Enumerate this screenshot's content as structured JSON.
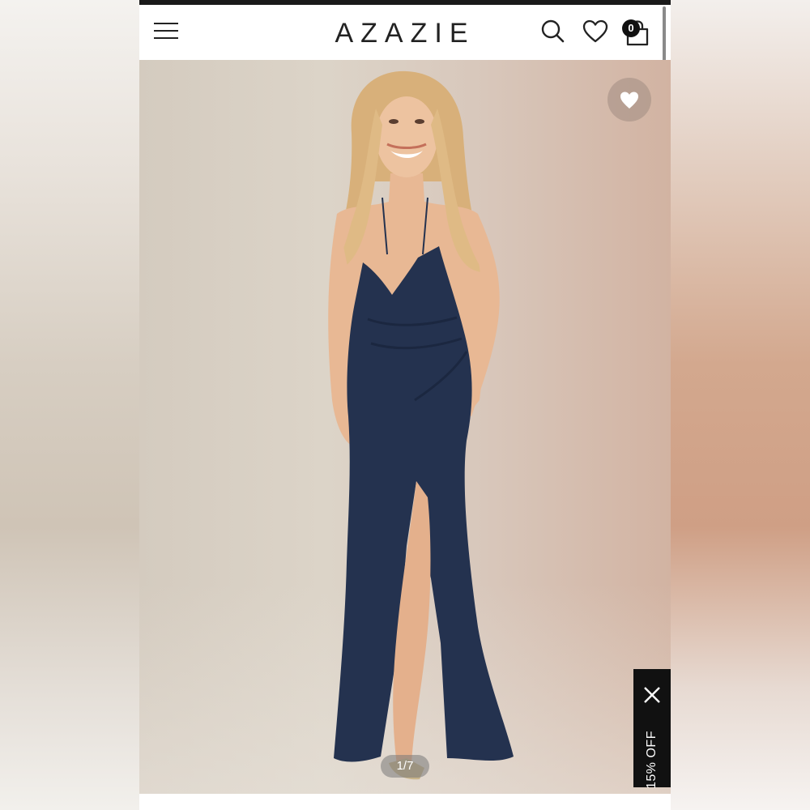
{
  "header": {
    "logo": "AZAZIE",
    "cart_count": "0"
  },
  "icons": {
    "menu": "hamburger-menu-icon",
    "search": "search-icon",
    "wishlist": "heart-outline-icon",
    "cart": "shopping-bag-icon",
    "favorite": "heart-filled-icon",
    "close": "close-icon"
  },
  "gallery": {
    "counter": "1/7"
  },
  "promo": {
    "label": "15% OFF"
  },
  "colors": {
    "dress": "#24324f",
    "brand_text": "#222222",
    "promo_bg": "#111111"
  }
}
